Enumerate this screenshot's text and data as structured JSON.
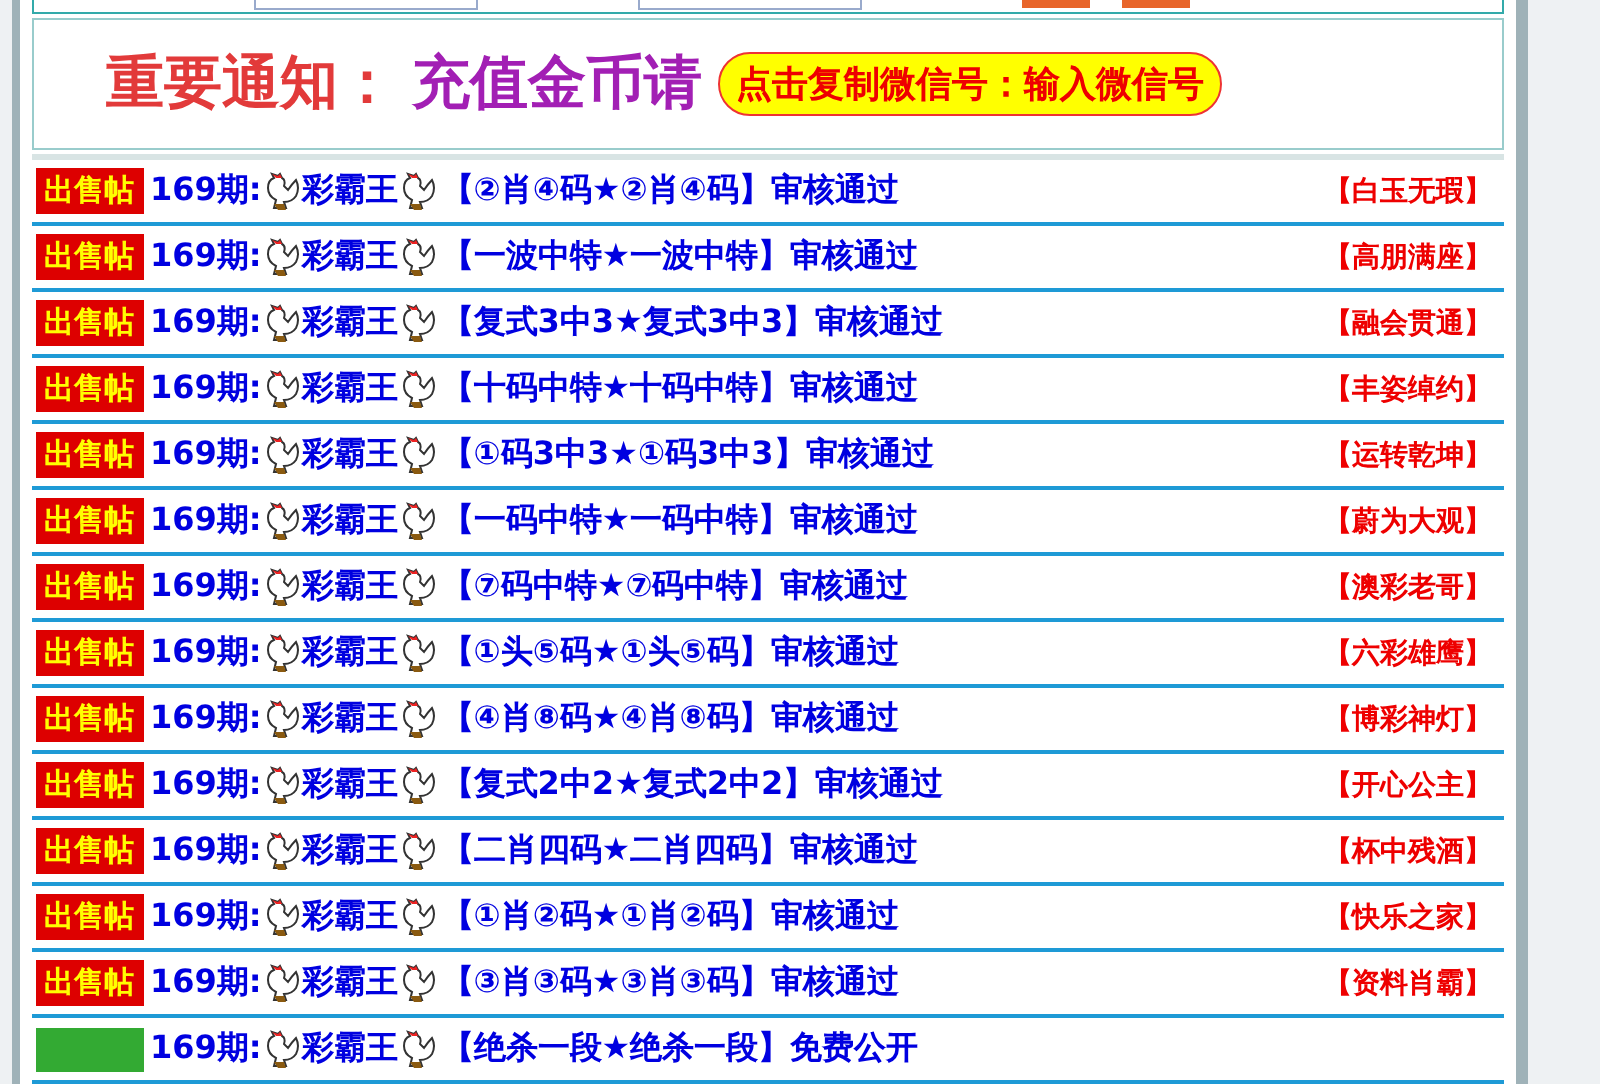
{
  "notice": {
    "title": "重要通知：",
    "subtitle": "充值金币请",
    "button": "点击复制微信号：输入微信号"
  },
  "posts": [
    {
      "kind": "sale",
      "badge": "出售帖",
      "issue": "169期:",
      "name": "彩霸王",
      "content": "【②肖④码★②肖④码】审核通过",
      "tag": "【白玉无瑕】"
    },
    {
      "kind": "sale",
      "badge": "出售帖",
      "issue": "169期:",
      "name": "彩霸王",
      "content": "【一波中特★一波中特】审核通过",
      "tag": "【高朋满座】"
    },
    {
      "kind": "sale",
      "badge": "出售帖",
      "issue": "169期:",
      "name": "彩霸王",
      "content": "【复式3中3★复式3中3】审核通过",
      "tag": "【融会贯通】"
    },
    {
      "kind": "sale",
      "badge": "出售帖",
      "issue": "169期:",
      "name": "彩霸王",
      "content": "【十码中特★十码中特】审核通过",
      "tag": "【丰姿绰约】"
    },
    {
      "kind": "sale",
      "badge": "出售帖",
      "issue": "169期:",
      "name": "彩霸王",
      "content": "【①码3中3★①码3中3】审核通过",
      "tag": "【运转乾坤】"
    },
    {
      "kind": "sale",
      "badge": "出售帖",
      "issue": "169期:",
      "name": "彩霸王",
      "content": "【一码中特★一码中特】审核通过",
      "tag": "【蔚为大观】"
    },
    {
      "kind": "sale",
      "badge": "出售帖",
      "issue": "169期:",
      "name": "彩霸王",
      "content": "【⑦码中特★⑦码中特】审核通过",
      "tag": "【澳彩老哥】"
    },
    {
      "kind": "sale",
      "badge": "出售帖",
      "issue": "169期:",
      "name": "彩霸王",
      "content": "【①头⑤码★①头⑤码】审核通过",
      "tag": "【六彩雄鹰】"
    },
    {
      "kind": "sale",
      "badge": "出售帖",
      "issue": "169期:",
      "name": "彩霸王",
      "content": "【④肖⑧码★④肖⑧码】审核通过",
      "tag": "【博彩神灯】"
    },
    {
      "kind": "sale",
      "badge": "出售帖",
      "issue": "169期:",
      "name": "彩霸王",
      "content": "【复式2中2★复式2中2】审核通过",
      "tag": "【开心公主】"
    },
    {
      "kind": "sale",
      "badge": "出售帖",
      "issue": "169期:",
      "name": "彩霸王",
      "content": "【二肖四码★二肖四码】审核通过",
      "tag": "【杯中残酒】"
    },
    {
      "kind": "sale",
      "badge": "出售帖",
      "issue": "169期:",
      "name": "彩霸王",
      "content": "【①肖②码★①肖②码】审核通过",
      "tag": "【快乐之家】"
    },
    {
      "kind": "sale",
      "badge": "出售帖",
      "issue": "169期:",
      "name": "彩霸王",
      "content": "【③肖③码★③肖③码】审核通过",
      "tag": "【资料肖霸】"
    },
    {
      "kind": "free",
      "issue": "169期:",
      "name": "彩霸王",
      "content": "【绝杀一段★绝杀一段】免费公开"
    }
  ]
}
